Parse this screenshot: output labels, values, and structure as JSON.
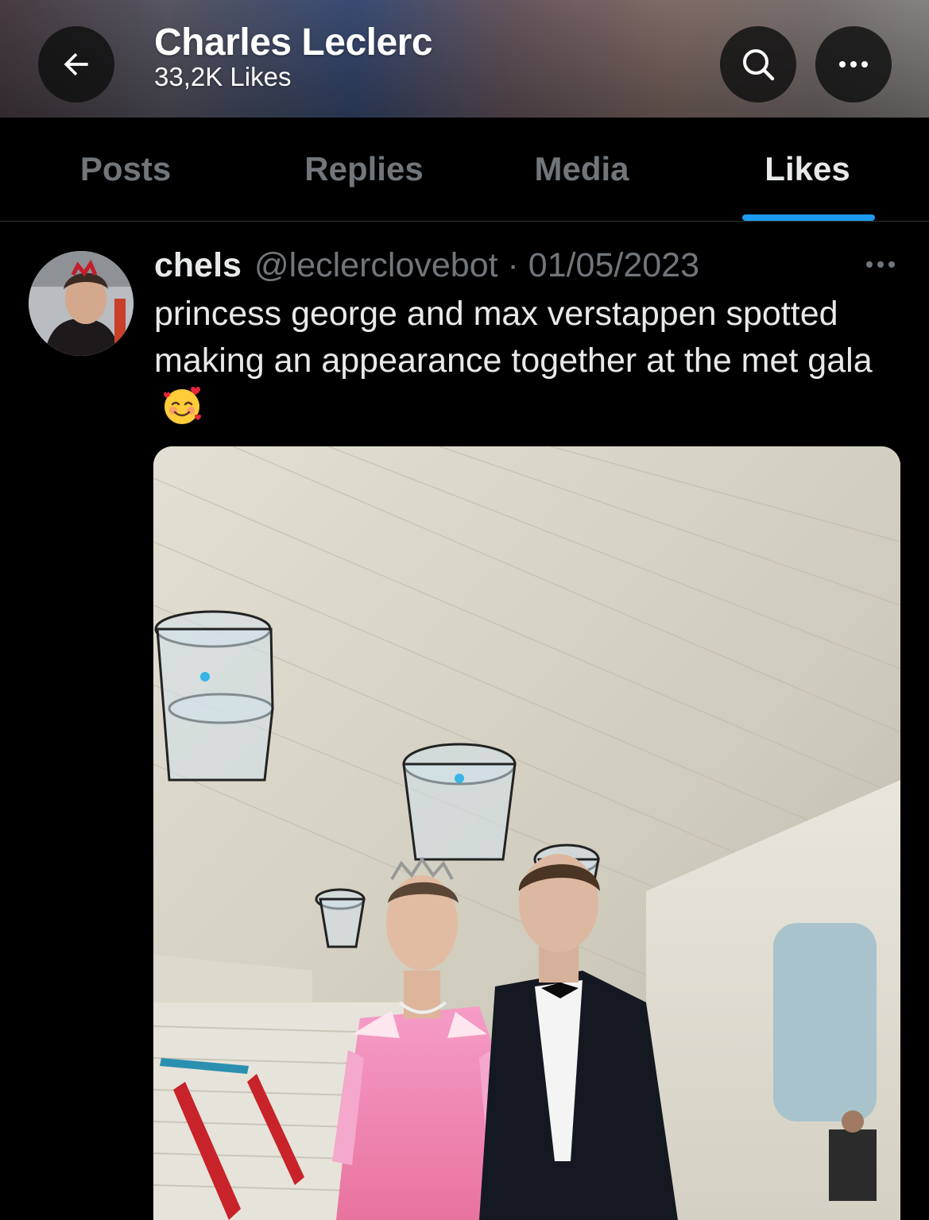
{
  "header": {
    "title": "Charles Leclerc",
    "subtitle": "33,2K Likes",
    "back_icon": "arrow-left-icon",
    "search_icon": "search-icon",
    "more_icon": "more-horizontal-icon"
  },
  "tabs": [
    {
      "label": "Posts",
      "active": false
    },
    {
      "label": "Replies",
      "active": false
    },
    {
      "label": "Media",
      "active": false
    },
    {
      "label": "Likes",
      "active": true
    }
  ],
  "post": {
    "name": "chels",
    "handle_date": "@leclerclovebot · 01/05/2023",
    "text": "princess george and max verstappen spotted making an appearance together at the met gala",
    "emoji": "smiling-face-with-hearts",
    "more_icon": "more-horizontal-icon"
  },
  "colors": {
    "accent": "#1d9bf0",
    "text_primary": "#e7e9ea",
    "text_secondary": "#71767b",
    "background": "#000000"
  }
}
